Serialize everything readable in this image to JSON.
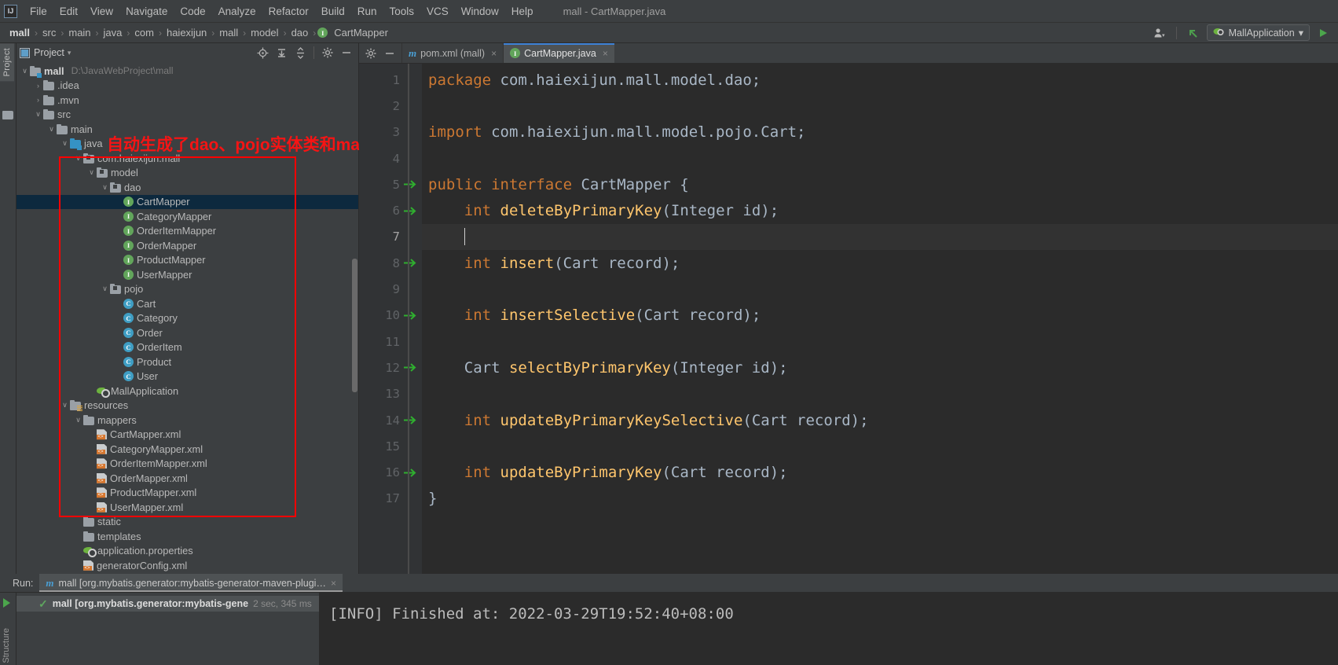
{
  "window": {
    "title": "mall - CartMapper.java"
  },
  "menubar": {
    "logo": "IJ",
    "items": [
      "File",
      "Edit",
      "View",
      "Navigate",
      "Code",
      "Analyze",
      "Refactor",
      "Build",
      "Run",
      "Tools",
      "VCS",
      "Window",
      "Help"
    ]
  },
  "breadcrumb": {
    "separator": "›",
    "items": [
      "mall",
      "src",
      "main",
      "java",
      "com",
      "haiexijun",
      "mall",
      "model",
      "dao",
      "CartMapper"
    ],
    "last_icon": "interface-icon"
  },
  "navbar_right": {
    "user_icon": "user-icon",
    "user_caret": "▾",
    "updates_icon": "arrow-up-left-icon",
    "run_config": {
      "icon": "spring-boot-icon",
      "label": "MallApplication",
      "caret": "▾"
    },
    "run_icon": "run-play-icon"
  },
  "left_tool_tabs": {
    "top": "Project",
    "bottom": "Structure"
  },
  "project_panel": {
    "title": "Project",
    "title_caret": "▾",
    "toolbar_icons": [
      "locate-icon",
      "expand-all-icon",
      "collapse-all-icon",
      "settings-gear-icon",
      "minimize-icon"
    ],
    "tree": [
      {
        "indent": 0,
        "arrow": "∨",
        "icon": "module-folder-icon",
        "label": "mall",
        "path": "D:\\JavaWebProject\\mall",
        "bold": true,
        "selected": false
      },
      {
        "indent": 1,
        "arrow": "›",
        "icon": "folder-icon",
        "label": ".idea",
        "path": "",
        "bold": false,
        "selected": false
      },
      {
        "indent": 1,
        "arrow": "›",
        "icon": "folder-icon",
        "label": ".mvn",
        "path": "",
        "bold": false,
        "selected": false
      },
      {
        "indent": 1,
        "arrow": "∨",
        "icon": "folder-icon",
        "label": "src",
        "path": "",
        "bold": false,
        "selected": false
      },
      {
        "indent": 2,
        "arrow": "∨",
        "icon": "folder-icon",
        "label": "main",
        "path": "",
        "bold": false,
        "selected": false
      },
      {
        "indent": 3,
        "arrow": "∨",
        "icon": "source-folder-icon",
        "label": "java",
        "path": "",
        "bold": false,
        "selected": false
      },
      {
        "indent": 4,
        "arrow": "∨",
        "icon": "package-icon",
        "label": "com.haiexijun.mall",
        "path": "",
        "bold": false,
        "selected": false
      },
      {
        "indent": 5,
        "arrow": "∨",
        "icon": "package-icon",
        "label": "model",
        "path": "",
        "bold": false,
        "selected": false
      },
      {
        "indent": 6,
        "arrow": "∨",
        "icon": "package-icon",
        "label": "dao",
        "path": "",
        "bold": false,
        "selected": false
      },
      {
        "indent": 7,
        "arrow": "",
        "icon": "interface-icon",
        "label": "CartMapper",
        "path": "",
        "bold": false,
        "selected": true
      },
      {
        "indent": 7,
        "arrow": "",
        "icon": "interface-icon",
        "label": "CategoryMapper",
        "path": "",
        "bold": false,
        "selected": false
      },
      {
        "indent": 7,
        "arrow": "",
        "icon": "interface-icon",
        "label": "OrderItemMapper",
        "path": "",
        "bold": false,
        "selected": false
      },
      {
        "indent": 7,
        "arrow": "",
        "icon": "interface-icon",
        "label": "OrderMapper",
        "path": "",
        "bold": false,
        "selected": false
      },
      {
        "indent": 7,
        "arrow": "",
        "icon": "interface-icon",
        "label": "ProductMapper",
        "path": "",
        "bold": false,
        "selected": false
      },
      {
        "indent": 7,
        "arrow": "",
        "icon": "interface-icon",
        "label": "UserMapper",
        "path": "",
        "bold": false,
        "selected": false
      },
      {
        "indent": 6,
        "arrow": "∨",
        "icon": "package-icon",
        "label": "pojo",
        "path": "",
        "bold": false,
        "selected": false
      },
      {
        "indent": 7,
        "arrow": "",
        "icon": "class-icon",
        "label": "Cart",
        "path": "",
        "bold": false,
        "selected": false
      },
      {
        "indent": 7,
        "arrow": "",
        "icon": "class-icon",
        "label": "Category",
        "path": "",
        "bold": false,
        "selected": false
      },
      {
        "indent": 7,
        "arrow": "",
        "icon": "class-icon",
        "label": "Order",
        "path": "",
        "bold": false,
        "selected": false
      },
      {
        "indent": 7,
        "arrow": "",
        "icon": "class-icon",
        "label": "OrderItem",
        "path": "",
        "bold": false,
        "selected": false
      },
      {
        "indent": 7,
        "arrow": "",
        "icon": "class-icon",
        "label": "Product",
        "path": "",
        "bold": false,
        "selected": false
      },
      {
        "indent": 7,
        "arrow": "",
        "icon": "class-icon",
        "label": "User",
        "path": "",
        "bold": false,
        "selected": false
      },
      {
        "indent": 5,
        "arrow": "",
        "icon": "spring-boot-icon",
        "label": "MallApplication",
        "path": "",
        "bold": false,
        "selected": false
      },
      {
        "indent": 3,
        "arrow": "∨",
        "icon": "resources-folder-icon",
        "label": "resources",
        "path": "",
        "bold": false,
        "selected": false
      },
      {
        "indent": 4,
        "arrow": "∨",
        "icon": "folder-icon",
        "label": "mappers",
        "path": "",
        "bold": false,
        "selected": false
      },
      {
        "indent": 5,
        "arrow": "",
        "icon": "xml-file-icon",
        "label": "CartMapper.xml",
        "path": "",
        "bold": false,
        "selected": false
      },
      {
        "indent": 5,
        "arrow": "",
        "icon": "xml-file-icon",
        "label": "CategoryMapper.xml",
        "path": "",
        "bold": false,
        "selected": false
      },
      {
        "indent": 5,
        "arrow": "",
        "icon": "xml-file-icon",
        "label": "OrderItemMapper.xml",
        "path": "",
        "bold": false,
        "selected": false
      },
      {
        "indent": 5,
        "arrow": "",
        "icon": "xml-file-icon",
        "label": "OrderMapper.xml",
        "path": "",
        "bold": false,
        "selected": false
      },
      {
        "indent": 5,
        "arrow": "",
        "icon": "xml-file-icon",
        "label": "ProductMapper.xml",
        "path": "",
        "bold": false,
        "selected": false
      },
      {
        "indent": 5,
        "arrow": "",
        "icon": "xml-file-icon",
        "label": "UserMapper.xml",
        "path": "",
        "bold": false,
        "selected": false
      },
      {
        "indent": 4,
        "arrow": "",
        "icon": "folder-icon",
        "label": "static",
        "path": "",
        "bold": false,
        "selected": false
      },
      {
        "indent": 4,
        "arrow": "",
        "icon": "folder-icon",
        "label": "templates",
        "path": "",
        "bold": false,
        "selected": false
      },
      {
        "indent": 4,
        "arrow": "",
        "icon": "spring-properties-icon",
        "label": "application.properties",
        "path": "",
        "bold": false,
        "selected": false
      },
      {
        "indent": 4,
        "arrow": "",
        "icon": "xml-file-icon",
        "label": "generatorConfig.xml",
        "path": "",
        "bold": false,
        "selected": false
      }
    ]
  },
  "annotation": {
    "text": "自动生成了dao、pojo实体类和mappers映射",
    "color": "#f61414"
  },
  "editor": {
    "tabs": [
      {
        "icon": "maven-icon",
        "label": "pom.xml (mall)",
        "active": false,
        "close": "×"
      },
      {
        "icon": "interface-icon",
        "label": "CartMapper.java",
        "active": true,
        "close": "×"
      }
    ],
    "tab_tools": [
      "settings-gear-icon",
      "minimize-icon"
    ],
    "lines": [
      {
        "num": "1",
        "mark": false,
        "current": false,
        "tokens": [
          {
            "t": "kw",
            "v": "package"
          },
          {
            "t": "plain",
            "v": " com.haiexijun.mall.model.dao;"
          }
        ]
      },
      {
        "num": "2",
        "mark": false,
        "current": false,
        "tokens": []
      },
      {
        "num": "3",
        "mark": false,
        "current": false,
        "tokens": [
          {
            "t": "kw",
            "v": "import"
          },
          {
            "t": "plain",
            "v": " com.haiexijun.mall.model.pojo.Cart;"
          }
        ]
      },
      {
        "num": "4",
        "mark": false,
        "current": false,
        "tokens": []
      },
      {
        "num": "5",
        "mark": true,
        "current": false,
        "tokens": [
          {
            "t": "kw",
            "v": "public interface"
          },
          {
            "t": "plain",
            "v": " CartMapper {"
          }
        ]
      },
      {
        "num": "6",
        "mark": true,
        "current": false,
        "tokens": [
          {
            "t": "plain",
            "v": "    "
          },
          {
            "t": "kw",
            "v": "int"
          },
          {
            "t": "plain",
            "v": " "
          },
          {
            "t": "mname",
            "v": "deleteByPrimaryKey"
          },
          {
            "t": "plain",
            "v": "(Integer id);"
          }
        ]
      },
      {
        "num": "7",
        "mark": false,
        "current": true,
        "tokens": [
          {
            "t": "plain",
            "v": "    "
          },
          {
            "t": "caret",
            "v": ""
          }
        ]
      },
      {
        "num": "8",
        "mark": true,
        "current": false,
        "tokens": [
          {
            "t": "plain",
            "v": "    "
          },
          {
            "t": "kw",
            "v": "int"
          },
          {
            "t": "plain",
            "v": " "
          },
          {
            "t": "mname",
            "v": "insert"
          },
          {
            "t": "plain",
            "v": "(Cart record);"
          }
        ]
      },
      {
        "num": "9",
        "mark": false,
        "current": false,
        "tokens": []
      },
      {
        "num": "10",
        "mark": true,
        "current": false,
        "tokens": [
          {
            "t": "plain",
            "v": "    "
          },
          {
            "t": "kw",
            "v": "int"
          },
          {
            "t": "plain",
            "v": " "
          },
          {
            "t": "mname",
            "v": "insertSelective"
          },
          {
            "t": "plain",
            "v": "(Cart record);"
          }
        ]
      },
      {
        "num": "11",
        "mark": false,
        "current": false,
        "tokens": []
      },
      {
        "num": "12",
        "mark": true,
        "current": false,
        "tokens": [
          {
            "t": "plain",
            "v": "    Cart "
          },
          {
            "t": "mname",
            "v": "selectByPrimaryKey"
          },
          {
            "t": "plain",
            "v": "(Integer id);"
          }
        ]
      },
      {
        "num": "13",
        "mark": false,
        "current": false,
        "tokens": []
      },
      {
        "num": "14",
        "mark": true,
        "current": false,
        "tokens": [
          {
            "t": "plain",
            "v": "    "
          },
          {
            "t": "kw",
            "v": "int"
          },
          {
            "t": "plain",
            "v": " "
          },
          {
            "t": "mname",
            "v": "updateByPrimaryKeySelective"
          },
          {
            "t": "plain",
            "v": "(Cart record);"
          }
        ]
      },
      {
        "num": "15",
        "mark": false,
        "current": false,
        "tokens": []
      },
      {
        "num": "16",
        "mark": true,
        "current": false,
        "tokens": [
          {
            "t": "plain",
            "v": "    "
          },
          {
            "t": "kw",
            "v": "int"
          },
          {
            "t": "plain",
            "v": " "
          },
          {
            "t": "mname",
            "v": "updateByPrimaryKey"
          },
          {
            "t": "plain",
            "v": "(Cart record);"
          }
        ]
      },
      {
        "num": "17",
        "mark": false,
        "current": false,
        "tokens": [
          {
            "t": "plain",
            "v": "}"
          }
        ]
      }
    ]
  },
  "run_panel": {
    "label": "Run:",
    "tab": {
      "icon": "maven-icon",
      "label": "mall [org.mybatis.generator:mybatis-generator-maven-plugi…",
      "close": "×"
    },
    "toolbar": {
      "play_icon": "run-play-icon"
    },
    "tree_node": {
      "status_icon": "check-icon",
      "name": "mall [org.mybatis.generator:mybatis-gene",
      "time": "2 sec, 345 ms"
    },
    "console": "[INFO] Finished at: 2022-03-29T19:52:40+08:00"
  }
}
